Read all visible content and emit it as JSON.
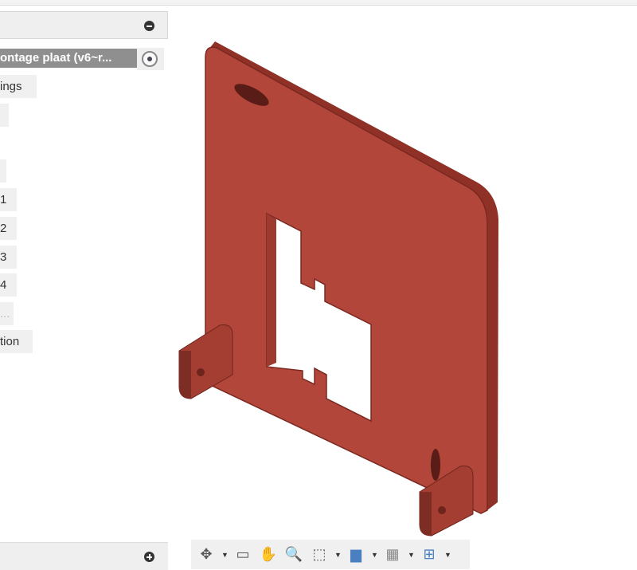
{
  "browser": {
    "selected_item": "ontage plaat (v6~r...",
    "items": [
      "ings",
      "",
      "",
      "1",
      "2",
      "3",
      "4",
      "...",
      "tion"
    ]
  },
  "toolbar": {
    "icons": [
      "orbit-icon",
      "look-at-icon",
      "pan-icon",
      "zoom-icon",
      "fit-icon",
      "display-settings-icon",
      "grid-settings-icon",
      "viewports-icon"
    ]
  },
  "colors": {
    "model": "#b2463a",
    "model_dark": "#8a2f26",
    "selected": "#8f8f8f"
  }
}
